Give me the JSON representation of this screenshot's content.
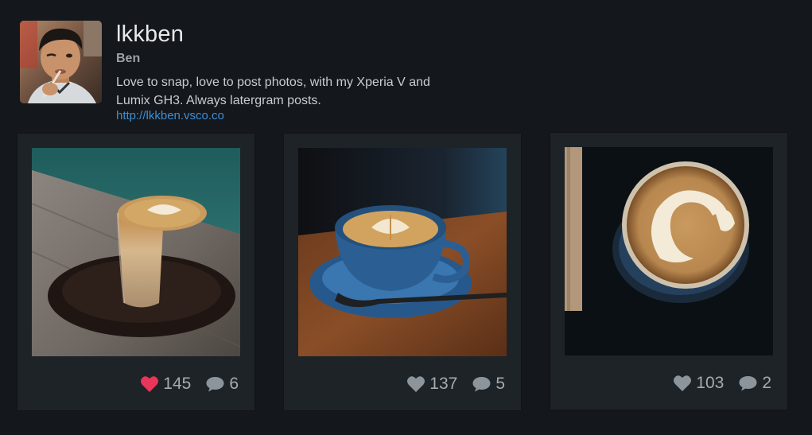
{
  "profile": {
    "username": "lkkben",
    "display_name": "Ben",
    "bio_lines": [
      "Love to snap, love to post photos, with my Xperia V and",
      "Lumix GH3. Always latergram posts."
    ],
    "link": "http://lkkben.vsco.co"
  },
  "photos": [
    {
      "likes": "145",
      "comments": "6",
      "liked": true
    },
    {
      "likes": "137",
      "comments": "5",
      "liked": false
    },
    {
      "likes": "103",
      "comments": "2",
      "liked": false
    }
  ],
  "colors": {
    "background": "#14171b",
    "card": "#1e2327",
    "link": "#3d8fd6",
    "heart_liked": "#e8365a",
    "icon_default": "#8d959c"
  },
  "icons": {
    "like": "heart-icon",
    "comment": "speech-bubble-icon"
  }
}
